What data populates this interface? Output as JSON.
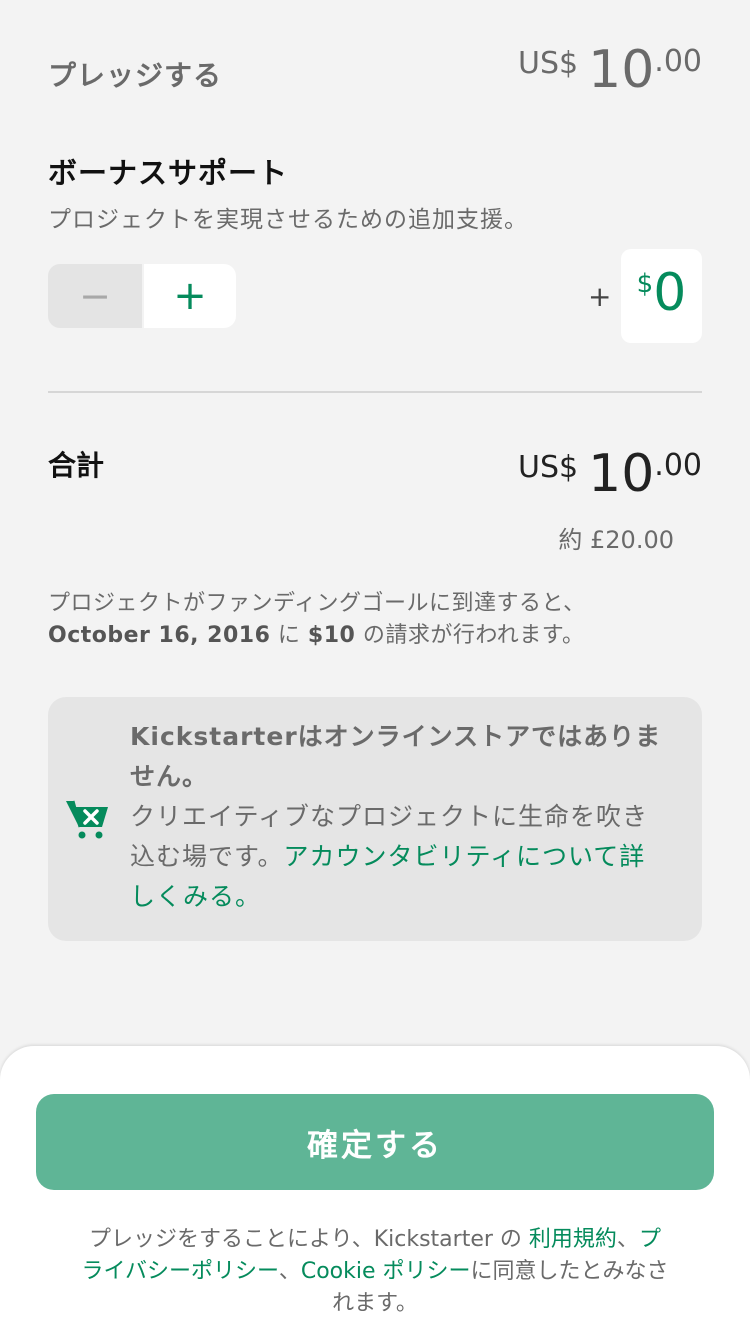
{
  "pledge": {
    "label": "プレッジする",
    "currency": "US$",
    "integer": "10",
    "decimal": ".00"
  },
  "bonus": {
    "title": "ボーナスサポート",
    "description": "プロジェクトを実現させるための追加支援。",
    "minus_symbol": "−",
    "plus_symbol": "+",
    "prefix": "+",
    "currency_symbol": "$",
    "value": "0"
  },
  "total": {
    "label": "合計",
    "currency": "US$",
    "integer": "10",
    "decimal": ".00",
    "approx": "約 £20.00"
  },
  "charge_note": {
    "line1": "プロジェクトがファンディングゴールに到達すると、",
    "date": "October 16, 2016",
    "mid": " に ",
    "amount": "$10",
    "tail": " の請求が行われます。"
  },
  "info_card": {
    "heading": "Kickstarterはオンラインストアではありません。",
    "body": "クリエイティブなプロジェクトに生命を吹き込む場です。",
    "link": "アカウンタビリティについて詳しくみる。",
    "icon": "cart-x-icon",
    "icon_color": "#058b5c"
  },
  "footer": {
    "confirm_label": "確定する",
    "terms_prefix": "プレッジをすることにより、Kickstarter の ",
    "terms_link": "利用規約",
    "sep": "、",
    "privacy_link": "プライバシーポリシー",
    "sep2": "、",
    "cookie_link": "Cookie ポリシー",
    "terms_suffix": "に同意したとみなされます。"
  },
  "colors": {
    "accent": "#058b5c",
    "button": "#5fb596",
    "background": "#f3f3f3"
  }
}
